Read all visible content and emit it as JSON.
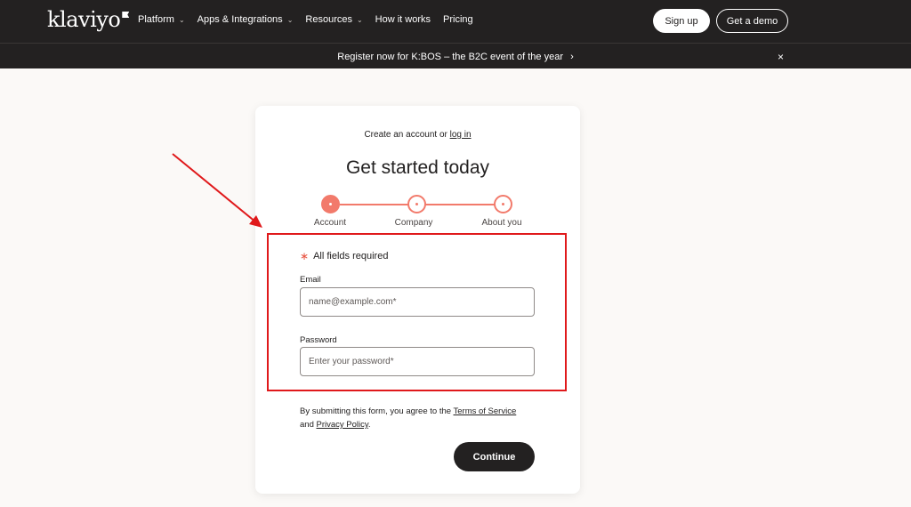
{
  "nav": {
    "logo": "klaviyo",
    "items": [
      {
        "label": "Platform",
        "has_menu": true
      },
      {
        "label": "Apps & Integrations",
        "has_menu": true
      },
      {
        "label": "Resources",
        "has_menu": true
      },
      {
        "label": "How it works",
        "has_menu": false
      },
      {
        "label": "Pricing",
        "has_menu": false
      }
    ],
    "signup_label": "Sign up",
    "demo_label": "Get a demo"
  },
  "announcement": {
    "text": "Register now for K:BOS – the B2C event of the year",
    "chevron": "›",
    "close": "×"
  },
  "signup_card": {
    "subtitle_prefix": "Create an account or",
    "login_link": "log in",
    "title": "Get started today",
    "steps": [
      {
        "label": "Account",
        "active": true
      },
      {
        "label": "Company",
        "active": false
      },
      {
        "label": "About you",
        "active": false
      }
    ],
    "required_star": "∗",
    "required_text": "All fields required",
    "email": {
      "label": "Email",
      "placeholder": "name@example.com*",
      "value": ""
    },
    "password": {
      "label": "Password",
      "placeholder": "Enter your password*",
      "value": ""
    },
    "legal_prefix": "By submitting this form, you agree to the",
    "terms_link": "Terms of Service",
    "legal_mid": "and",
    "privacy_link": "Privacy Policy",
    "legal_suffix": ".",
    "continue_label": "Continue"
  },
  "colors": {
    "nav_bg": "#232121",
    "page_bg": "#fbf9f7",
    "accent": "#f27a6b",
    "annotation": "#e0191b"
  }
}
